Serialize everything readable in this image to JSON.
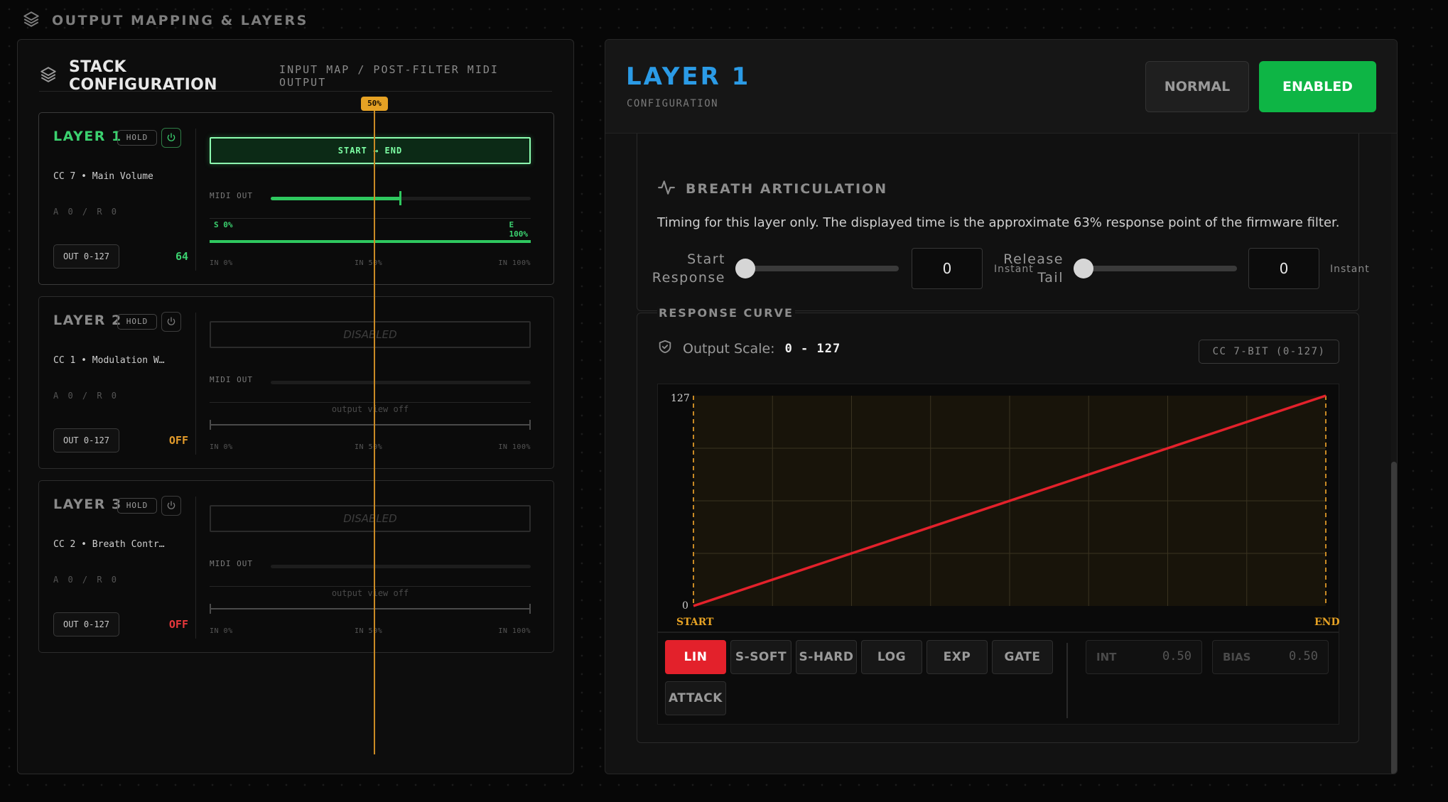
{
  "header": {
    "title": "OUTPUT MAPPING & LAYERS",
    "icon": "layers-icon"
  },
  "stack": {
    "title": "STACK CONFIGURATION",
    "subtitle": "INPUT MAP / POST-FILTER MIDI OUTPUT",
    "playhead_label": "50%",
    "playhead_value": 0.5,
    "layers": [
      {
        "name": "LAYER 1",
        "hold": "HOLD",
        "cc": "CC 7 • Main Volume",
        "ar": "A 0 / R 0",
        "out": "OUT 0-127",
        "value": "64",
        "value_color": "#3bd16f",
        "enabled": true,
        "range_label": "START → END",
        "midi_label": "MIDI OUT",
        "midi_level": 0.5,
        "curve_start": "S 0%",
        "curve_end_letter": "E",
        "curve_end": "100%",
        "in_labels": [
          "IN 0%",
          "IN 50%",
          "IN 100%"
        ]
      },
      {
        "name": "LAYER 2",
        "hold": "HOLD",
        "cc": "CC 1 • Modulation W…",
        "ar": "A 0 / R 0",
        "out": "OUT 0-127",
        "value": "OFF",
        "value_color": "#e39b2b",
        "enabled": false,
        "range_label": "DISABLED",
        "midi_label": "MIDI OUT",
        "view_off": "output view off",
        "in_labels": [
          "IN 0%",
          "IN 50%",
          "IN 100%"
        ]
      },
      {
        "name": "LAYER 3",
        "hold": "HOLD",
        "cc": "CC 2 • Breath Contr…",
        "ar": "A 0 / R 0",
        "out": "OUT 0-127",
        "value": "OFF",
        "value_color": "#e8383c",
        "enabled": false,
        "range_label": "DISABLED",
        "midi_label": "MIDI OUT",
        "view_off": "output view off",
        "in_labels": [
          "IN 0%",
          "IN 50%",
          "IN 100%"
        ]
      }
    ]
  },
  "detail": {
    "title": "LAYER 1",
    "subtitle": "CONFIGURATION",
    "mode_button": "NORMAL",
    "enabled_button": "ENABLED",
    "breath": {
      "title": "BREATH ARTICULATION",
      "description": "Timing for this layer only. The displayed time is the approximate 63% response point of the firmware filter.",
      "start_label_1": "Start",
      "start_label_2": "Response",
      "start_value": "0",
      "start_level": 0,
      "start_note": "Instant",
      "release_label_1": "Release",
      "release_label_2": "Tail",
      "release_value": "0",
      "release_level": 0,
      "release_note": "Instant"
    },
    "response": {
      "title": "RESPONSE CURVE",
      "scale_label": "Output Scale:",
      "scale_value": "0 - 127",
      "cc_badge": "CC 7-BIT (0-127)",
      "y_max_label": "127",
      "y_min_label": "0",
      "x_start_label": "START",
      "x_end_label": "END",
      "curve_color": "#e3212b",
      "curve_buttons": [
        "LIN",
        "S-SOFT",
        "S-HARD",
        "LOG",
        "EXP",
        "GATE",
        "ATTACK"
      ],
      "active_curve": "LIN",
      "int_label": "INT",
      "int_value": "0.50",
      "bias_label": "BIAS",
      "bias_value": "0.50"
    }
  }
}
